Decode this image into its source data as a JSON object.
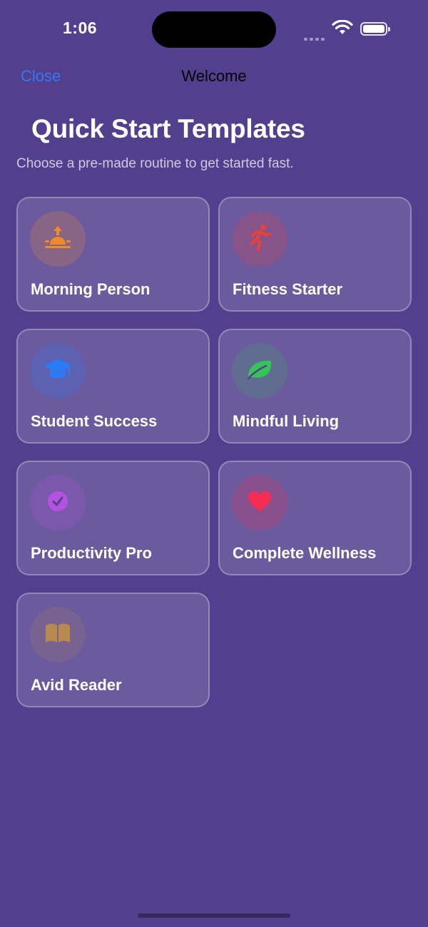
{
  "status_bar": {
    "time": "1:06"
  },
  "nav": {
    "close_label": "Close",
    "title": "Welcome",
    "close_color": "#2f7bf5"
  },
  "header": {
    "title": "Quick Start Templates",
    "subtitle": "Choose a pre-made routine to get started fast."
  },
  "templates": [
    {
      "label": "Morning Person",
      "icon": "sunrise-icon",
      "color": "#f08c28"
    },
    {
      "label": "Fitness Starter",
      "icon": "running-figure-icon",
      "color": "#e8413a"
    },
    {
      "label": "Student Success",
      "icon": "graduation-cap-icon",
      "color": "#2a7bf6"
    },
    {
      "label": "Mindful Living",
      "icon": "leaf-icon",
      "color": "#35c35a"
    },
    {
      "label": "Productivity Pro",
      "icon": "checkmark-circle-icon",
      "color": "#b452e0"
    },
    {
      "label": "Complete Wellness",
      "icon": "heart-icon",
      "color": "#f52d55"
    },
    {
      "label": "Avid Reader",
      "icon": "book-icon",
      "color": "#b88a4e"
    }
  ],
  "theme": {
    "background": "#533f8e"
  }
}
